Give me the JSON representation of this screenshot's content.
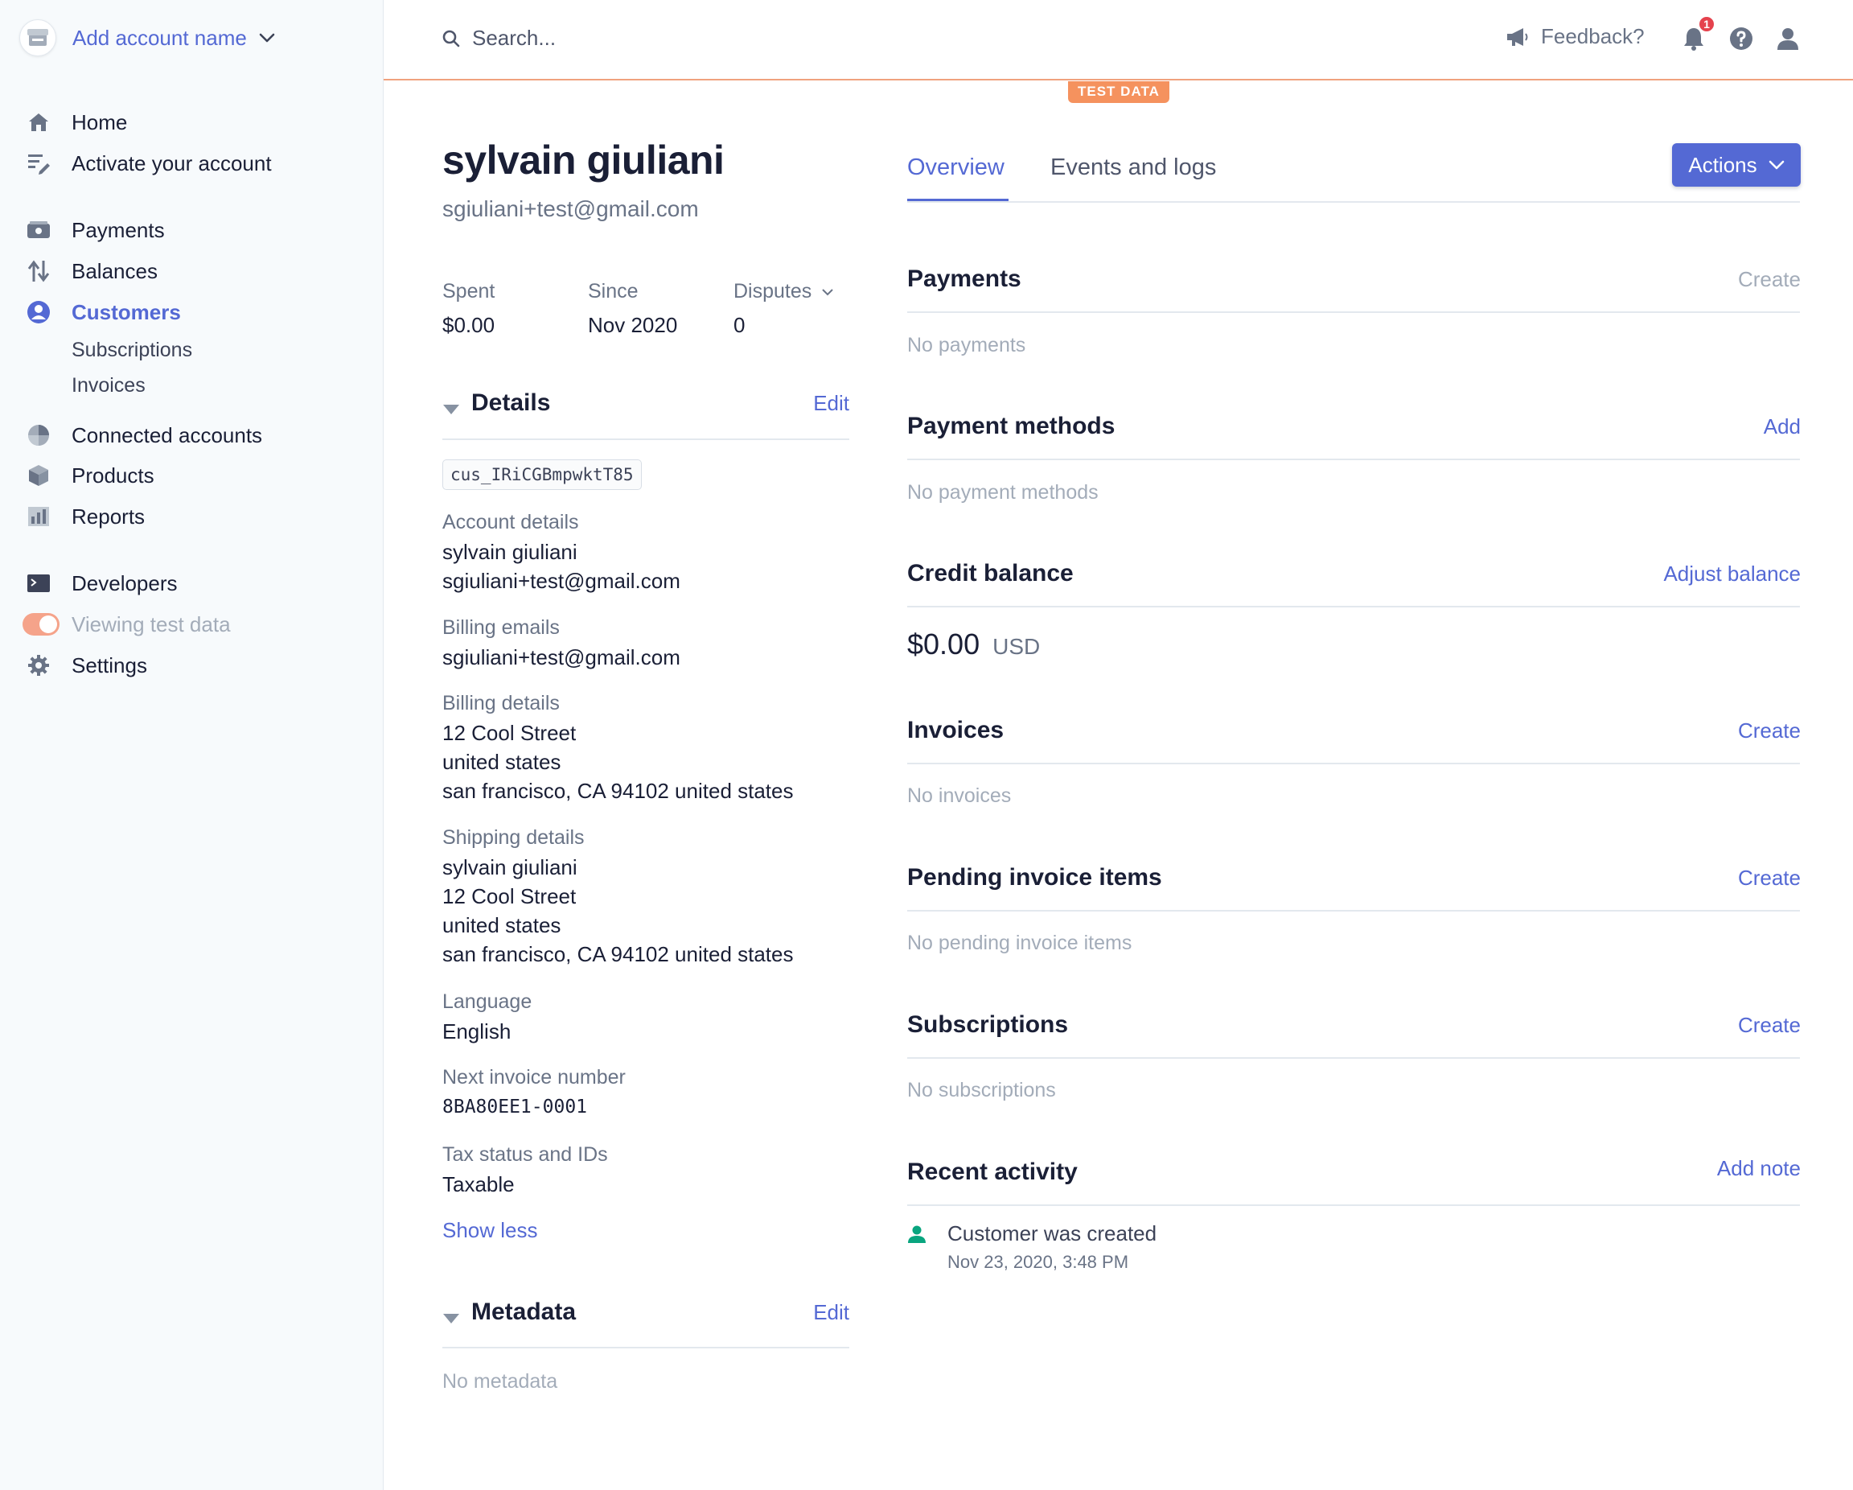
{
  "sidebar": {
    "account_name": "Add account name",
    "nav": {
      "home": "Home",
      "activate": "Activate your account",
      "payments": "Payments",
      "balances": "Balances",
      "customers": "Customers",
      "subscriptions": "Subscriptions",
      "invoices": "Invoices",
      "connected": "Connected accounts",
      "products": "Products",
      "reports": "Reports",
      "developers": "Developers",
      "test_data": "Viewing test data",
      "settings": "Settings"
    }
  },
  "topbar": {
    "search_placeholder": "Search...",
    "feedback": "Feedback?",
    "notification_count": "1",
    "test_badge": "TEST DATA"
  },
  "customer": {
    "name": "sylvain giuliani",
    "email": "sgiuliani+test@gmail.com",
    "stats": {
      "spent_label": "Spent",
      "spent_value": "$0.00",
      "since_label": "Since",
      "since_value": "Nov 2020",
      "disputes_label": "Disputes",
      "disputes_value": "0"
    },
    "details": {
      "title": "Details",
      "edit": "Edit",
      "id": "cus_IRiCGBmpwktT85",
      "account_label": "Account details",
      "account_name": "sylvain giuliani",
      "account_email": "sgiuliani+test@gmail.com",
      "billing_emails_label": "Billing emails",
      "billing_email": "sgiuliani+test@gmail.com",
      "billing_details_label": "Billing details",
      "billing_line1": "12 Cool Street",
      "billing_line2": "united states",
      "billing_line3": "san francisco, CA 94102 united states",
      "shipping_label": "Shipping details",
      "shipping_line1": "sylvain giuliani",
      "shipping_line2": "12 Cool Street",
      "shipping_line3": "united states",
      "shipping_line4": "san francisco, CA 94102 united states",
      "language_label": "Language",
      "language_value": "English",
      "next_invoice_label": "Next invoice number",
      "next_invoice_value": "8BA80EE1-0001",
      "tax_label": "Tax status and IDs",
      "tax_value": "Taxable",
      "show_less": "Show less"
    },
    "metadata": {
      "title": "Metadata",
      "edit": "Edit",
      "empty": "No metadata"
    }
  },
  "tabs": {
    "overview": "Overview",
    "events": "Events and logs"
  },
  "actions_button": "Actions",
  "sections": {
    "payments": {
      "title": "Payments",
      "action": "Create",
      "empty": "No payments"
    },
    "payment_methods": {
      "title": "Payment methods",
      "action": "Add",
      "empty": "No payment methods"
    },
    "credit_balance": {
      "title": "Credit balance",
      "action": "Adjust balance",
      "amount": "$0.00",
      "currency": "USD"
    },
    "invoices": {
      "title": "Invoices",
      "action": "Create",
      "empty": "No invoices"
    },
    "pending_items": {
      "title": "Pending invoice items",
      "action": "Create",
      "empty": "No pending invoice items"
    },
    "subscriptions": {
      "title": "Subscriptions",
      "action": "Create",
      "empty": "No subscriptions"
    },
    "recent_activity": {
      "title": "Recent activity",
      "action": "Add note",
      "event_text": "Customer was created",
      "event_time": "Nov 23, 2020, 3:48 PM"
    }
  },
  "colors": {
    "accent": "#5469d4",
    "test_mode": "#f5925e",
    "text": "#1a1f36",
    "muted": "#697386",
    "success": "#09a57f"
  },
  "icons": [
    "store-icon",
    "chevron-down-icon",
    "home-icon",
    "activate-icon",
    "payments-icon",
    "balances-icon",
    "customers-icon",
    "connect-icon",
    "products-icon",
    "reports-icon",
    "developers-icon",
    "gear-icon",
    "search-icon",
    "megaphone-icon",
    "bell-icon",
    "help-icon",
    "user-icon",
    "caret-down-icon",
    "person-icon"
  ]
}
